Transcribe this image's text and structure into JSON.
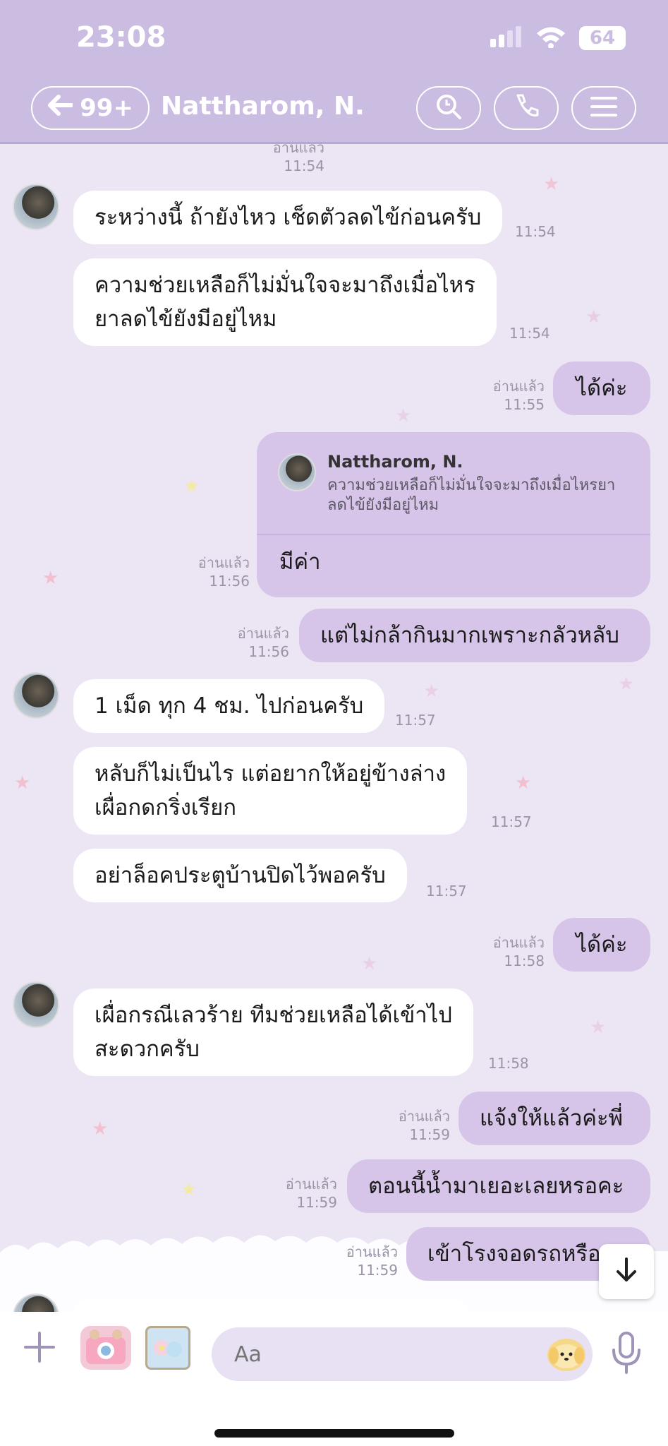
{
  "status": {
    "time": "23:08",
    "battery": "64"
  },
  "header": {
    "back_count": "99+",
    "title": "Nattharom, N."
  },
  "messages": [
    {
      "dir": "out",
      "meta_read": "อ่านแล้ว",
      "time": "11:54"
    },
    {
      "dir": "in",
      "text": "ระหว่างนี้ ถ้ายังไหว เช็ดตัวลดไข้ก่อนครับ",
      "time": "11:54"
    },
    {
      "dir": "in",
      "line1": "ความช่วยเหลือก็ไม่มั่นใจจะมาถึงเมื่อไหร",
      "line2": "ยาลดไข้ยังมีอยู่ไหม",
      "time": "11:54"
    },
    {
      "dir": "out",
      "text": "ได้ค่ะ",
      "meta_read": "อ่านแล้ว",
      "time": "11:55"
    },
    {
      "dir": "out",
      "reply_name": "Nattharom, N.",
      "reply_quote": "ความช่วยเหลือก็ไม่มั่นใจจะมาถึงเมื่อไหรยาลดไข้ยังมีอยู่ไหม",
      "text": "มีค่า",
      "meta_read": "อ่านแล้ว",
      "time": "11:56"
    },
    {
      "dir": "out",
      "text": "แต่ไม่กล้ากินมากเพราะกลัวหลับ",
      "meta_read": "อ่านแล้ว",
      "time": "11:56"
    },
    {
      "dir": "in",
      "text": "1 เม็ด ทุก 4 ชม. ไปก่อนครับ",
      "time": "11:57"
    },
    {
      "dir": "in",
      "line1": "หลับก็ไม่เป็นไร แต่อยากให้อยู่ข้างล่าง",
      "line2": "เผื่อกดกริ่งเรียก",
      "time": "11:57"
    },
    {
      "dir": "in",
      "text": "อย่าล็อคประตูบ้านปิดไว้พอครับ",
      "time": "11:57"
    },
    {
      "dir": "out",
      "text": "ได้ค่ะ",
      "meta_read": "อ่านแล้ว",
      "time": "11:58"
    },
    {
      "dir": "in",
      "line1": "เผื่อกรณีเลวร้าย ทีมช่วยเหลือได้เข้าไป",
      "line2": "สะดวกครับ",
      "time": "11:58"
    },
    {
      "dir": "out",
      "text": "แจ้งให้แล้วค่ะพี่",
      "meta_read": "อ่านแล้ว",
      "time": "11:59"
    },
    {
      "dir": "out",
      "text": "ตอนนี้น้ำมาเยอะเลยหรอคะ",
      "meta_read": "อ่านแล้ว",
      "time": "11:59"
    },
    {
      "dir": "out",
      "text": "เข้าโรงจอดรถหรือ",
      "meta_read": "อ่านแล้ว",
      "time": "11:59"
    }
  ],
  "input": {
    "placeholder": "Aa"
  },
  "colors": {
    "header_bg": "#cbbde2",
    "chat_bg": "#ece6f4",
    "outgoing_bubble": "#d6c5e8",
    "incoming_bubble": "#ffffff"
  }
}
